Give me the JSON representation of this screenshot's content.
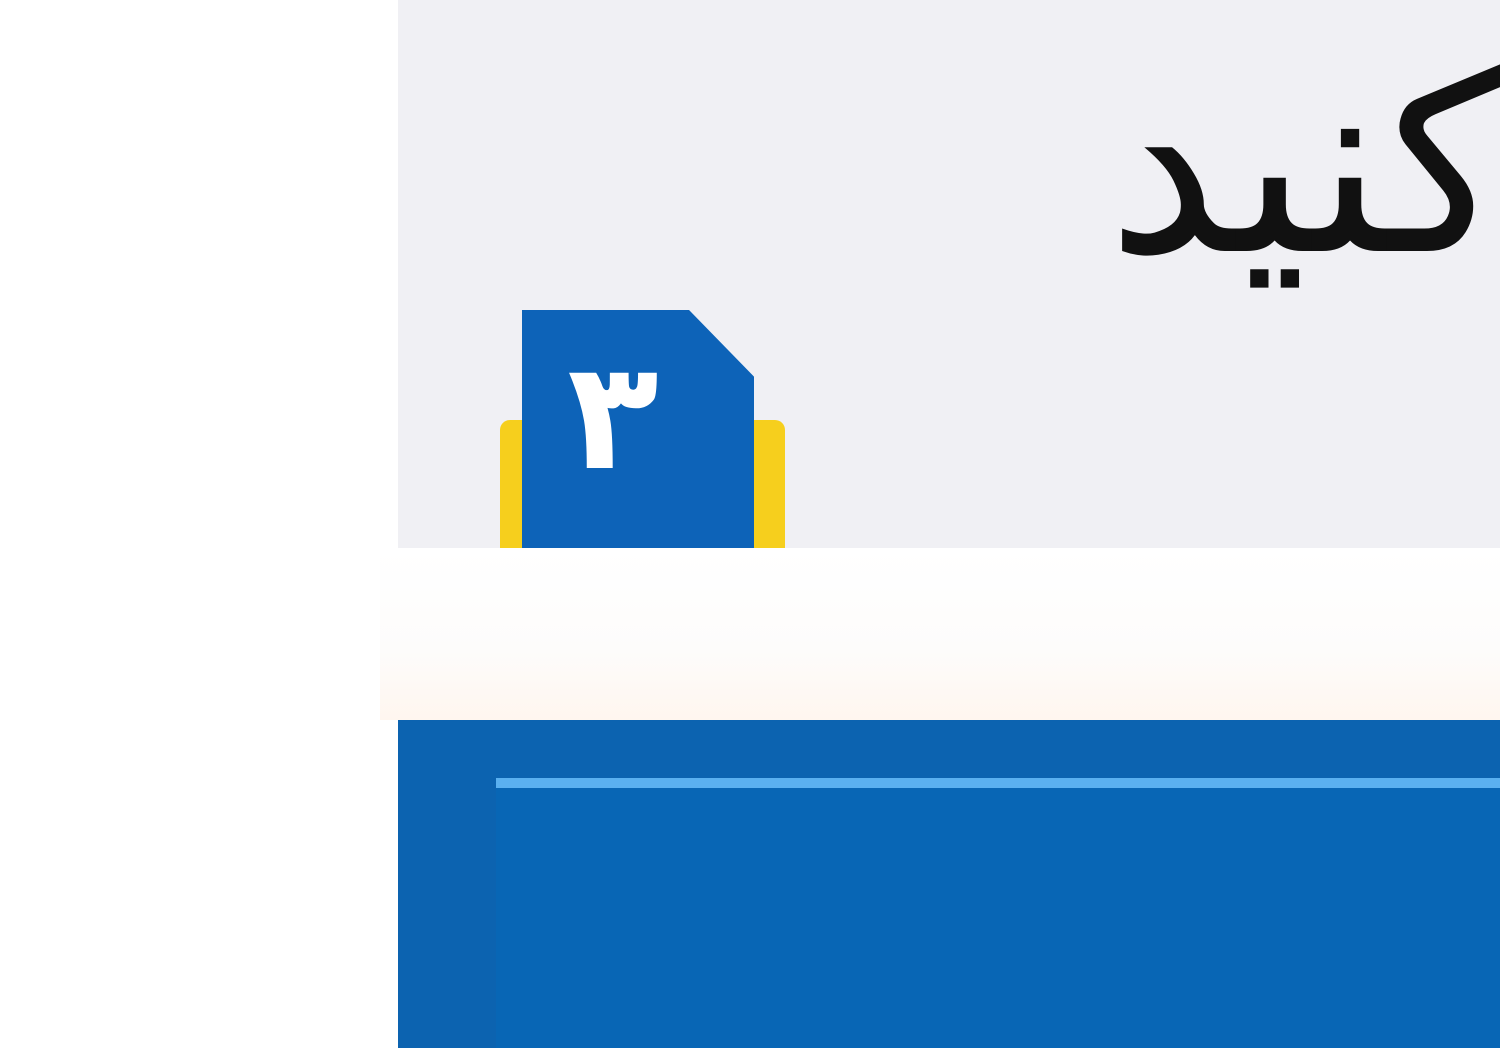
{
  "instruction": {
    "text": "کنید"
  },
  "step_badge": {
    "number": "۳"
  },
  "colors": {
    "panel_bg": "#f0f0f4",
    "badge_blue": "#0d63b8",
    "badge_accent": "#f6cf1d",
    "bar_blue": "#0c63b0",
    "bar_highlight": "#5ab0f0"
  }
}
